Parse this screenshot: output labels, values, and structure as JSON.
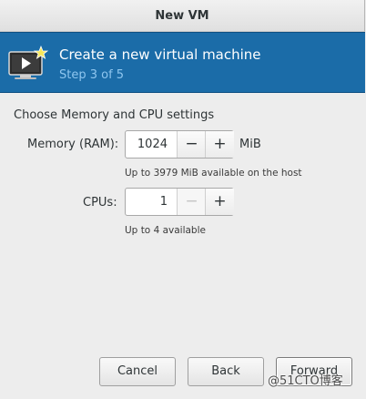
{
  "window": {
    "title": "New VM"
  },
  "header": {
    "title": "Create a new virtual machine",
    "step": "Step 3 of 5",
    "icon": "vm-monitor-icon",
    "background": "#1b6ca8",
    "step_color": "#8fc6ef"
  },
  "form": {
    "section_title": "Choose Memory and CPU settings",
    "memory": {
      "label": "Memory (RAM):",
      "value": "1024",
      "unit": "MiB",
      "hint": "Up to 3979 MiB available on the host",
      "decrement": "−",
      "increment": "+"
    },
    "cpus": {
      "label": "CPUs:",
      "value": "1",
      "hint": "Up to 4 available",
      "decrement": "−",
      "increment": "+"
    }
  },
  "buttons": {
    "cancel": "Cancel",
    "back": "Back",
    "forward": "Forward"
  },
  "watermark": "@51CTO博客"
}
